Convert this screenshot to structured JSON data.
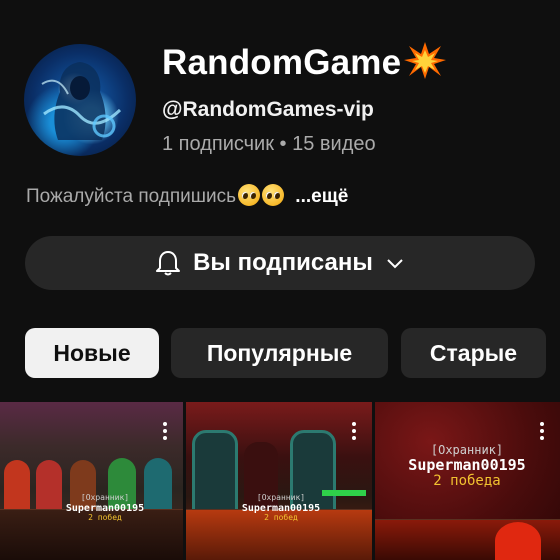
{
  "channel": {
    "name": "RandomGame",
    "handle": "@RandomGames-vip",
    "meta": "1 подписчик • 15 видео",
    "description": "Пожалуйста подпишись",
    "more_label": "...ещё",
    "avatar_icon": "hooded-figure-avatar",
    "name_icon": "collision-burst-icon",
    "description_emoji": "pleading-face-emoji"
  },
  "subscribe_button": {
    "label": "Вы подписаны",
    "bell_icon": "bell-icon",
    "chevron_icon": "chevron-down-icon"
  },
  "filter_chips": [
    {
      "label": "Новые",
      "active": true
    },
    {
      "label": "Популярные",
      "active": false
    },
    {
      "label": "Старые",
      "active": false
    }
  ],
  "videos": [
    {
      "tag": "[Охранник]",
      "name": "Superman00195",
      "wins": "2 побед"
    },
    {
      "tag": "[Охранник]",
      "name": "Superman00195",
      "wins": "2 побед"
    },
    {
      "tag": "[Охранник]",
      "name": "Superman00195",
      "wins": "2 победа"
    }
  ],
  "colors": {
    "background": "#0f0f0f",
    "button_bg": "#272727",
    "active_chip": "#f1f1f1",
    "secondary_text": "#aaaaaa",
    "wins_text": "#f2c230"
  }
}
